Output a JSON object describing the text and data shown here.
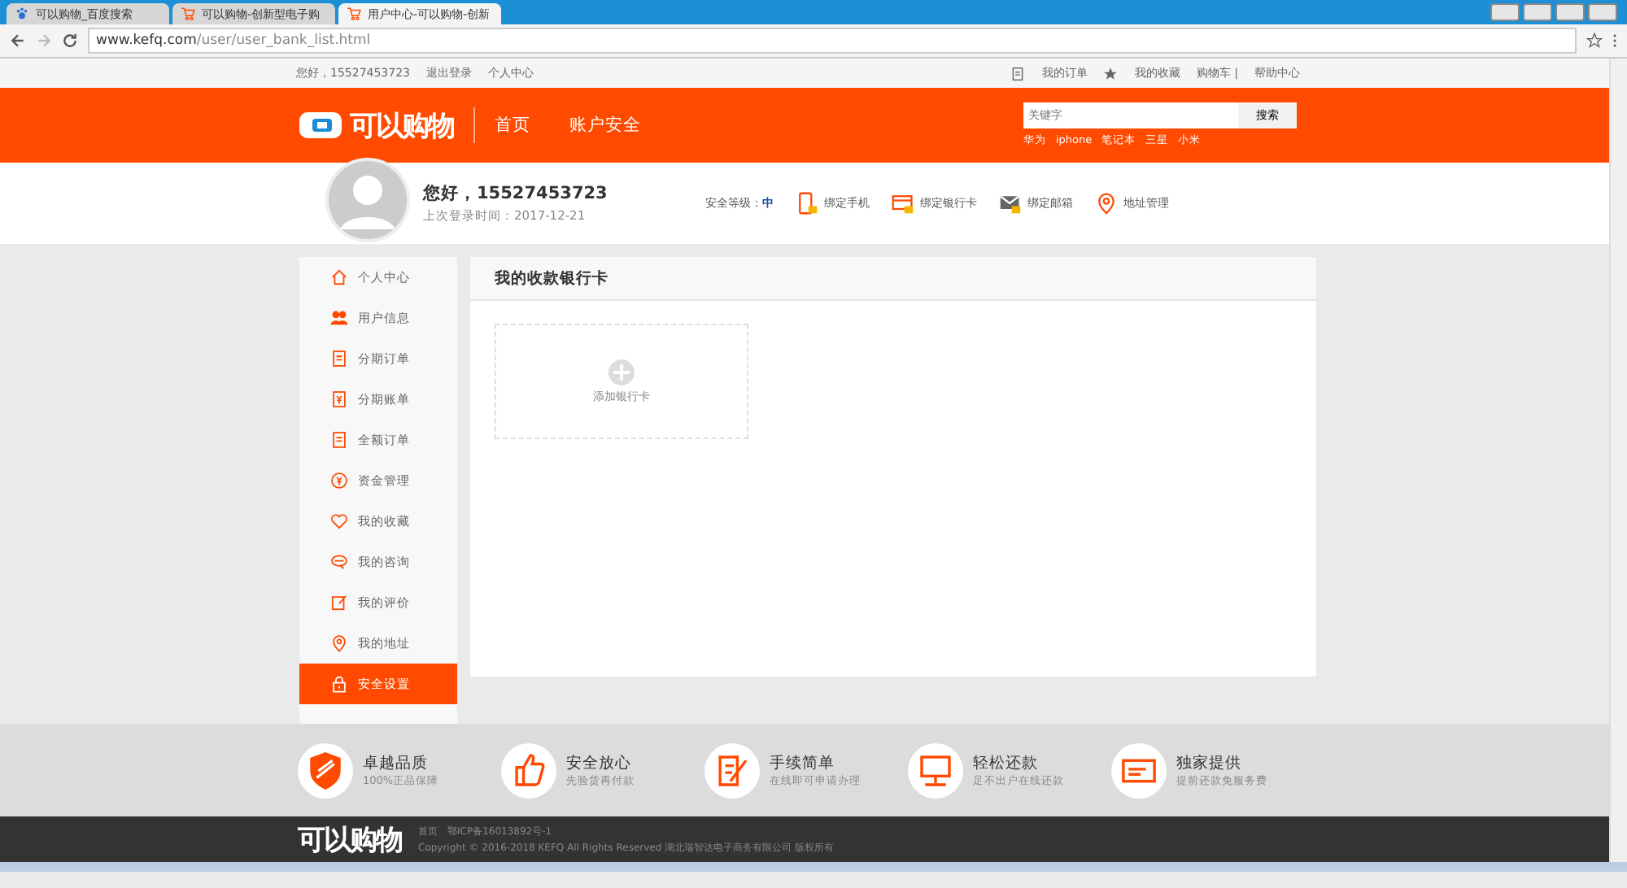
{
  "browser": {
    "tabs": [
      {
        "title": "可以购物_百度搜索",
        "kind": "paw",
        "selected": false
      },
      {
        "title": "可以购物-创新型电子购",
        "kind": "cart",
        "selected": false
      },
      {
        "title": "用户中心-可以购物-创新",
        "kind": "cart",
        "selected": true
      }
    ],
    "url_host": "www.kefq.com",
    "url_path": "/user/user_bank_list.html"
  },
  "topbar": {
    "left": [
      "您好，15527453723",
      "退出登录",
      "个人中心"
    ],
    "right": [
      {
        "label": "我的订单",
        "kind": "doc"
      },
      {
        "label": "我的收藏",
        "kind": "star"
      },
      {
        "label": "购物车 |",
        "kind": "plain"
      },
      {
        "label": "帮助中心",
        "kind": "plain"
      }
    ]
  },
  "header": {
    "logo": "可以购物",
    "nav": [
      "首页",
      "账户安全"
    ],
    "search": {
      "placeholder": "关键字",
      "button": "搜索"
    },
    "hot": [
      "华为",
      "iphone",
      "笔记本",
      "三星",
      "小米"
    ]
  },
  "user": {
    "greeting": "您好，15527453723",
    "last_login": "上次登录时间：2017-12-21",
    "security_label": "安全等级：",
    "security_level": "中",
    "links": [
      {
        "label": "绑定手机",
        "kind": "phone"
      },
      {
        "label": "绑定银行卡",
        "kind": "card"
      },
      {
        "label": "绑定邮箱",
        "kind": "mail"
      },
      {
        "label": "地址管理",
        "kind": "pin"
      }
    ]
  },
  "sidebar": {
    "items": [
      {
        "label": "个人中心",
        "kind": "home",
        "selected": false
      },
      {
        "label": "用户信息",
        "kind": "users",
        "selected": false
      },
      {
        "label": "分期订单",
        "kind": "doc",
        "selected": false
      },
      {
        "label": "分期账单",
        "kind": "yen",
        "selected": false
      },
      {
        "label": "全额订单",
        "kind": "doc",
        "selected": false
      },
      {
        "label": "资金管理",
        "kind": "coin",
        "selected": false
      },
      {
        "label": "我的收藏",
        "kind": "heart",
        "selected": false
      },
      {
        "label": "我的咨询",
        "kind": "chat",
        "selected": false
      },
      {
        "label": "我的评价",
        "kind": "edit",
        "selected": false
      },
      {
        "label": "我的地址",
        "kind": "pin",
        "selected": false
      },
      {
        "label": "安全设置",
        "kind": "lock",
        "selected": true
      }
    ]
  },
  "main": {
    "title": "我的收款银行卡",
    "add_card": "添加银行卡"
  },
  "features": [
    {
      "title": "卓越品质",
      "sub": "100%正品保障",
      "kind": "shield"
    },
    {
      "title": "安全放心",
      "sub": "先验货再付款",
      "kind": "thumb"
    },
    {
      "title": "手续简单",
      "sub": "在线即可申请办理",
      "kind": "form"
    },
    {
      "title": "轻松还款",
      "sub": "足不出户在线还款",
      "kind": "monitor"
    },
    {
      "title": "独家提供",
      "sub": "提前还款免服务费",
      "kind": "card"
    }
  ],
  "footer": {
    "logo": "可以购物",
    "links": [
      "首页",
      "鄂ICP备16013892号-1"
    ],
    "copyright": "Copyright © 2016-2018 KEFQ All Rights Reserved 湖北瑞智达电子商务有限公司 版权所有"
  }
}
